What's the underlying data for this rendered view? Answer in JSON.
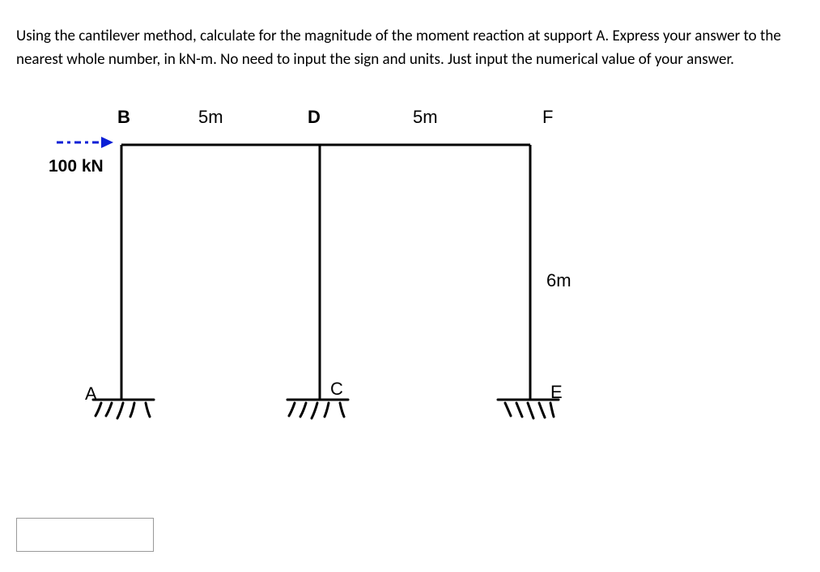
{
  "question": {
    "text": "Using the cantilever method, calculate for the magnitude of the moment reaction at support A. Express your answer to the nearest whole number, in kN-m. No need to input the sign and units. Just input the numerical value of your answer."
  },
  "diagram": {
    "labels": {
      "B": "B",
      "D": "D",
      "F": "F",
      "A": "A",
      "C": "C",
      "E": "E",
      "span_BD": "5m",
      "span_DF": "5m",
      "height": "6m",
      "load": "100 kN"
    }
  },
  "answer": {
    "value": "",
    "placeholder": ""
  }
}
